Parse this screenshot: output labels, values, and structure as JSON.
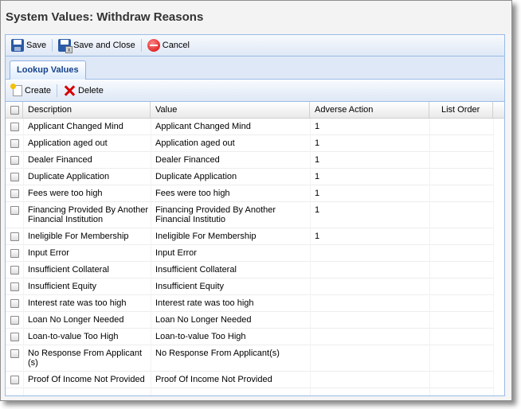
{
  "window": {
    "title": "System Values: Withdraw Reasons"
  },
  "toolbar": {
    "save": "Save",
    "save_and_close": "Save and Close",
    "cancel": "Cancel"
  },
  "tabs": [
    {
      "label": "Lookup Values"
    }
  ],
  "grid_toolbar": {
    "create": "Create",
    "delete": "Delete"
  },
  "grid": {
    "columns": [
      "Description",
      "Value",
      "Adverse Action",
      "List Order"
    ],
    "rows": [
      {
        "description": "Applicant Changed Mind",
        "value": "Applicant Changed Mind",
        "adverse_action": "1",
        "list_order": ""
      },
      {
        "description": "Application aged out",
        "value": "Application aged out",
        "adverse_action": "1",
        "list_order": ""
      },
      {
        "description": "Dealer Financed",
        "value": "Dealer Financed",
        "adverse_action": "1",
        "list_order": ""
      },
      {
        "description": "Duplicate Application",
        "value": "Duplicate Application",
        "adverse_action": "1",
        "list_order": ""
      },
      {
        "description": "Fees were too high",
        "value": "Fees were too high",
        "adverse_action": "1",
        "list_order": ""
      },
      {
        "description": "Financing Provided By Another Financial Institution",
        "value": "Financing Provided By Another Financial Institutio",
        "adverse_action": "1",
        "list_order": ""
      },
      {
        "description": "Ineligible For Membership",
        "value": "Ineligible For Membership",
        "adverse_action": "1",
        "list_order": ""
      },
      {
        "description": "Input Error",
        "value": "Input Error",
        "adverse_action": "",
        "list_order": ""
      },
      {
        "description": "Insufficient Collateral",
        "value": "Insufficient Collateral",
        "adverse_action": "",
        "list_order": ""
      },
      {
        "description": "Insufficient Equity",
        "value": "Insufficient Equity",
        "adverse_action": "",
        "list_order": ""
      },
      {
        "description": "Interest rate was too high",
        "value": "Interest rate was too high",
        "adverse_action": "",
        "list_order": ""
      },
      {
        "description": "Loan No Longer Needed",
        "value": "Loan No Longer Needed",
        "adverse_action": "",
        "list_order": ""
      },
      {
        "description": "Loan-to-value Too High",
        "value": "Loan-to-value Too High",
        "adverse_action": "",
        "list_order": ""
      },
      {
        "description": "No Response From Applicant (s)",
        "value": "No Response From Applicant(s)",
        "adverse_action": "",
        "list_order": ""
      },
      {
        "description": "Proof Of Income Not Provided",
        "value": "Proof Of Income Not Provided",
        "adverse_action": "",
        "list_order": ""
      }
    ]
  }
}
